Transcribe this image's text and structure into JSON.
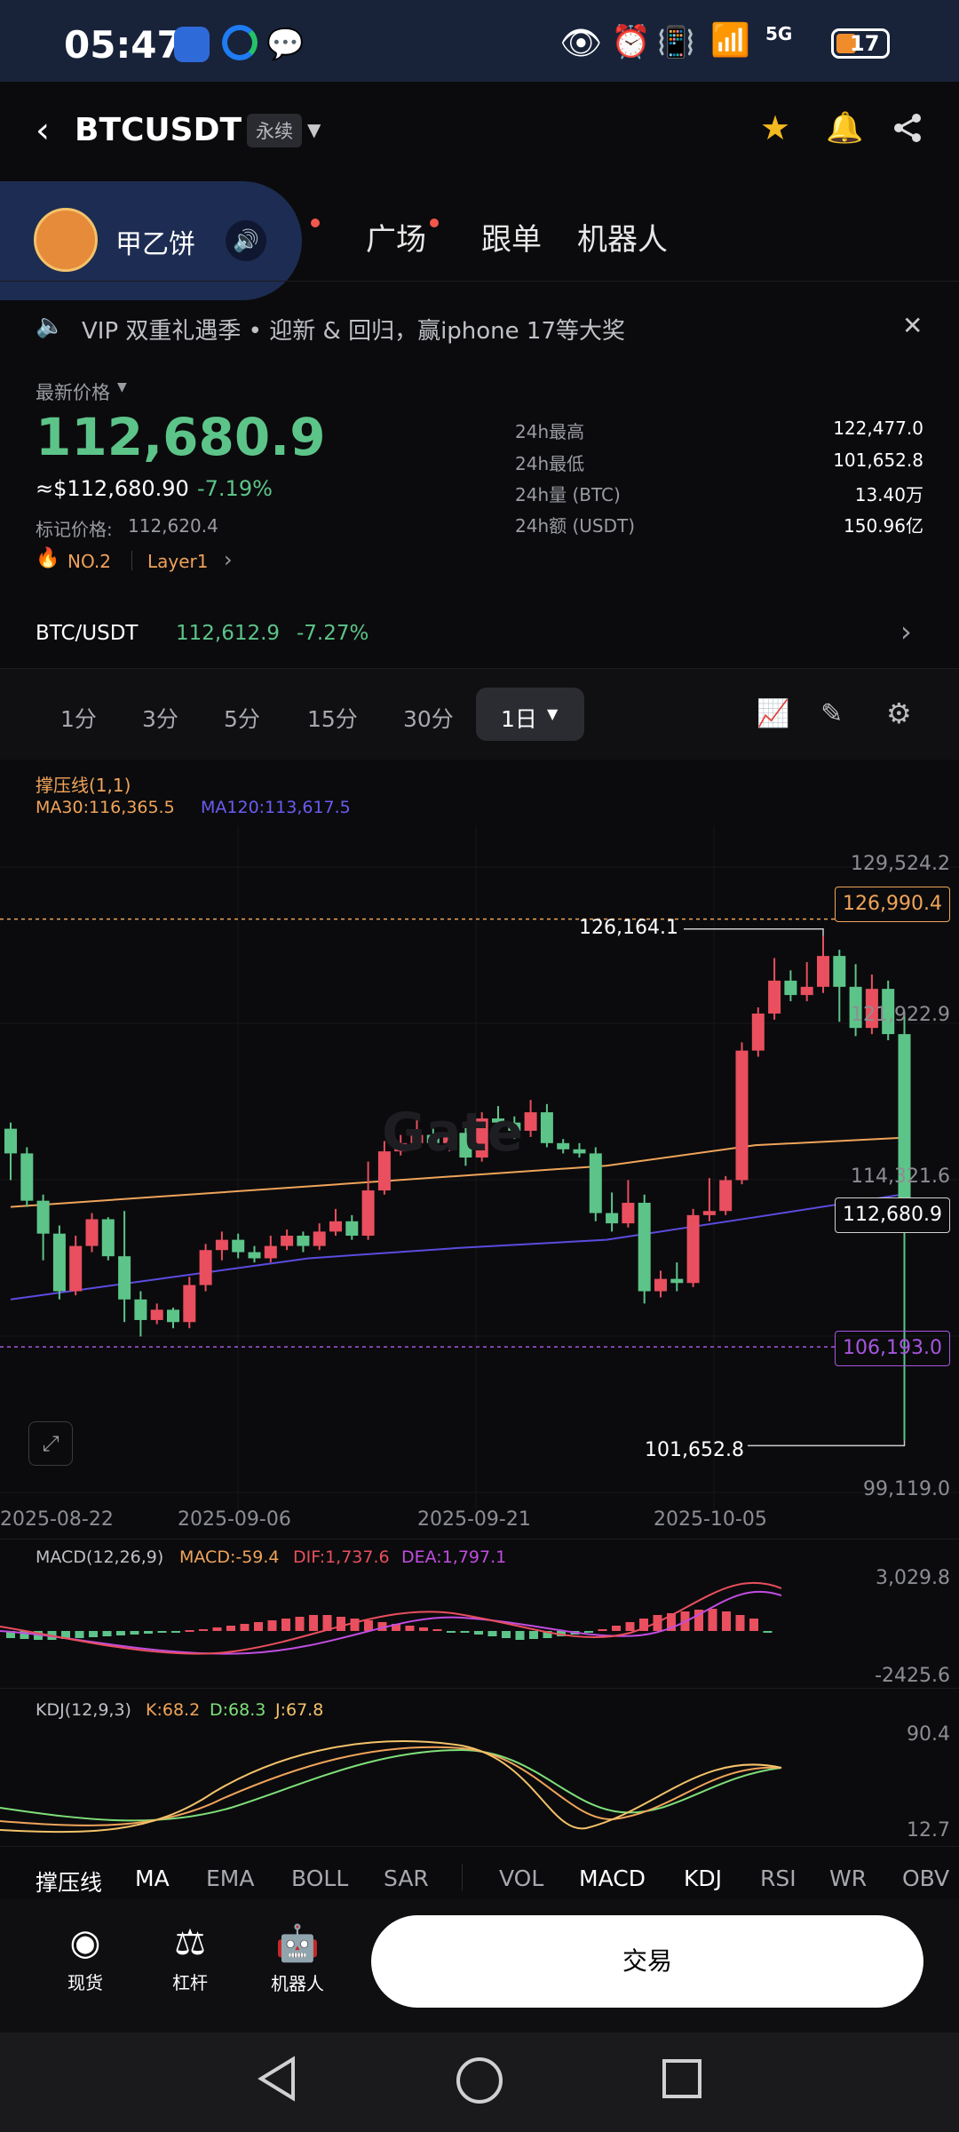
{
  "status": {
    "time": "05:47",
    "battery": "17",
    "network": "5G"
  },
  "header": {
    "symbol": "BTCUSDT",
    "contract_tag": "永续"
  },
  "overlay": {
    "name": "甲乙饼"
  },
  "main_tabs": [
    "广场",
    "跟单",
    "机器人"
  ],
  "announcement": "VIP 双重礼遇季 • 迎新 & 回归，赢iphone 17等大奖",
  "price": {
    "label": "最新价格",
    "last": "112,680.9",
    "usd": "≈$112,680.90",
    "change": "-7.19%",
    "mark_label": "标记价格:",
    "mark": "112,620.4",
    "rank": "NO.2",
    "category": "Layer1"
  },
  "stats": [
    {
      "label": "24h最高",
      "value": "122,477.0"
    },
    {
      "label": "24h最低",
      "value": "101,652.8"
    },
    {
      "label": "24h量 (BTC)",
      "value": "13.40万"
    },
    {
      "label": "24h额 (USDT)",
      "value": "150.96亿"
    }
  ],
  "spot": {
    "pair": "BTC/USDT",
    "price": "112,612.9",
    "change": "-7.27%"
  },
  "timeframes": [
    "1分",
    "3分",
    "5分",
    "15分",
    "30分",
    "1日"
  ],
  "chart": {
    "indicator_title": "撑压线(1,1)",
    "ma30": "MA30:116,365.5",
    "ma120": "MA120:113,617.5",
    "watermark": "Gate",
    "y_ticks": [
      "129,524.2",
      "121,922.9",
      "114,321.6",
      "99,119.0"
    ],
    "resistance": "126,990.4",
    "support": "106,193.0",
    "current": "112,680.9",
    "high_label": "126,164.1",
    "low_label": "101,652.8",
    "x_ticks": [
      "2025-08-22",
      "2025-09-06",
      "2025-09-21",
      "2025-10-05"
    ],
    "colors": {
      "up": "#e94f5e",
      "down": "#5dc489",
      "ma30": "#f0a45a",
      "ma120": "#5b4ce0"
    }
  },
  "chart_data": {
    "type": "candlestick",
    "x": [
      "2025-08-22",
      "2025-09-06",
      "2025-09-21",
      "2025-10-05"
    ],
    "ylim": [
      99119.0,
      129524.2
    ],
    "y_ticks": [
      129524.2,
      121922.9,
      114321.6,
      99119.0
    ],
    "current_price": 112680.9,
    "resistance": 126990.4,
    "support": 106193.0,
    "marked_high": 126164.1,
    "marked_low": 101652.8,
    "candles": [
      [
        116800,
        115600,
        117100,
        114300
      ],
      [
        115600,
        113300,
        115900,
        113000
      ],
      [
        113300,
        111700,
        113600,
        110400
      ],
      [
        111700,
        108900,
        112100,
        108500
      ],
      [
        108900,
        111100,
        111600,
        108700
      ],
      [
        111100,
        112400,
        112700,
        110800
      ],
      [
        112400,
        110600,
        112500,
        110400
      ],
      [
        110600,
        108500,
        112800,
        107400
      ],
      [
        108500,
        107500,
        108900,
        106700
      ],
      [
        107500,
        108000,
        108300,
        107300
      ],
      [
        108000,
        107400,
        108100,
        107100
      ],
      [
        107400,
        109200,
        109600,
        107100
      ],
      [
        109200,
        110900,
        111200,
        108900
      ],
      [
        110900,
        111400,
        111800,
        110400
      ],
      [
        111400,
        110800,
        111700,
        110500
      ],
      [
        110800,
        110500,
        111100,
        110300
      ],
      [
        110500,
        111100,
        111600,
        110300
      ],
      [
        111100,
        111600,
        111900,
        110900
      ],
      [
        111600,
        111100,
        111800,
        110800
      ],
      [
        111100,
        111800,
        112200,
        110900
      ],
      [
        111800,
        112300,
        112900,
        111600
      ],
      [
        112300,
        111600,
        112600,
        111400
      ],
      [
        111600,
        113800,
        115200,
        111400
      ],
      [
        113800,
        115700,
        116200,
        113600
      ],
      [
        115700,
        116100,
        116500,
        115500
      ],
      [
        116100,
        116500,
        117300,
        115800
      ],
      [
        116500,
        116100,
        116800,
        115800
      ],
      [
        116100,
        116600,
        116800,
        115700
      ],
      [
        116600,
        115400,
        117100,
        115000
      ],
      [
        115400,
        117300,
        117600,
        115200
      ],
      [
        117300,
        117100,
        117900,
        116700
      ],
      [
        117100,
        116700,
        117400,
        116300
      ],
      [
        116700,
        117600,
        118200,
        116400
      ],
      [
        117600,
        116100,
        118000,
        115900
      ],
      [
        116100,
        115800,
        116300,
        115600
      ],
      [
        115800,
        115600,
        116100,
        115400
      ],
      [
        115600,
        112700,
        115900,
        112300
      ],
      [
        112700,
        112200,
        113700,
        111800
      ],
      [
        112200,
        113200,
        114300,
        112000
      ],
      [
        113200,
        108900,
        113600,
        108300
      ],
      [
        108900,
        109500,
        109900,
        108600
      ],
      [
        109500,
        109300,
        110300,
        108900
      ],
      [
        109300,
        112600,
        112900,
        109100
      ],
      [
        112600,
        112800,
        114400,
        112300
      ],
      [
        112800,
        114300,
        114500,
        112600
      ],
      [
        114300,
        120600,
        121000,
        114100
      ],
      [
        120600,
        122400,
        122700,
        120300
      ],
      [
        122400,
        124000,
        125100,
        122100
      ],
      [
        124000,
        123300,
        124500,
        123000
      ],
      [
        123300,
        123700,
        124900,
        123000
      ],
      [
        123700,
        125200,
        126164,
        123400
      ],
      [
        125200,
        123700,
        125500,
        122000
      ],
      [
        123700,
        121700,
        124800,
        121300
      ],
      [
        121700,
        123600,
        124300,
        121400
      ],
      [
        123600,
        121400,
        124000,
        121100
      ],
      [
        121400,
        112600,
        122477,
        101652
      ]
    ],
    "ma30": [
      113000,
      113500,
      114000,
      114500,
      115000,
      116000,
      116365.5
    ],
    "ma120": [
      108500,
      109500,
      110500,
      111000,
      111400,
      112500,
      113617.5
    ],
    "macd": {
      "params": "MACD(12,26,9)",
      "macd": -59.4,
      "dif": 1737.6,
      "dea": 1797.1,
      "ylim": [
        -2425.6,
        3029.8
      ]
    },
    "kdj": {
      "params": "KDJ(12,9,3)",
      "k": 68.2,
      "d": 68.3,
      "j": 67.8,
      "ylim": [
        12.7,
        90.4
      ]
    }
  },
  "sub": {
    "macd_label": "MACD(12,26,9)",
    "macd_val": "MACD:-59.4",
    "dif_val": "DIF:1,737.6",
    "dea_val": "DEA:1,797.1",
    "macd_hi": "3,029.8",
    "macd_lo": "-2425.6",
    "kdj_label": "KDJ(12,9,3)",
    "k_val": "K:68.2",
    "d_val": "D:68.3",
    "j_val": "J:67.8",
    "kdj_hi": "90.4",
    "kdj_lo": "12.7"
  },
  "indicator_tabs": [
    "撑压线",
    "MA",
    "EMA",
    "BOLL",
    "SAR",
    "VOL",
    "MACD",
    "KDJ",
    "RSI",
    "WR",
    "OBV"
  ],
  "bottom_nav": [
    {
      "label": "现货",
      "icon": "spot-icon"
    },
    {
      "label": "杠杆",
      "icon": "margin-icon"
    },
    {
      "label": "机器人",
      "icon": "robot-icon"
    }
  ],
  "trade_button": "交易"
}
